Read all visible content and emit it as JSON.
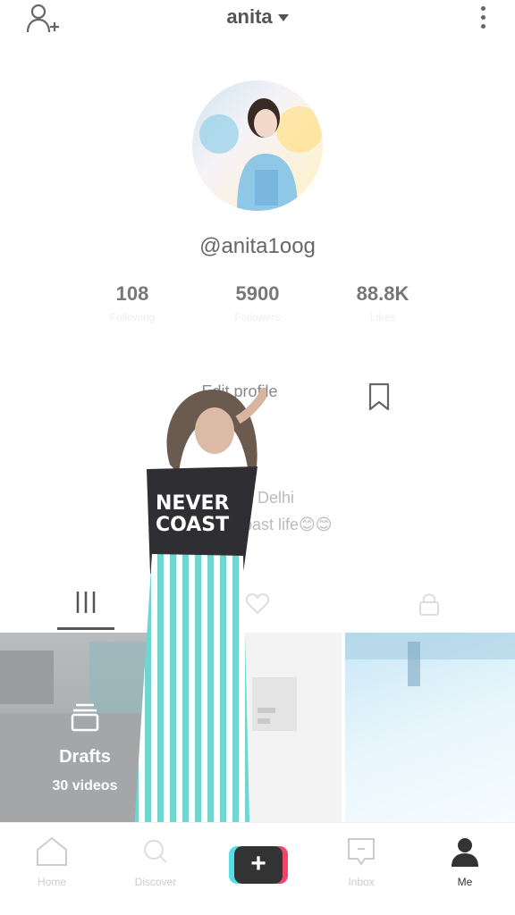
{
  "header": {
    "title": "anita",
    "add_user_icon": "add-user-icon",
    "more_icon": "more-vertical-icon"
  },
  "profile": {
    "handle": "@anita1oog",
    "stats": [
      {
        "value": "108",
        "label": "Following"
      },
      {
        "value": "5900",
        "label": "Followers"
      },
      {
        "value": "88.8K",
        "label": "Likes"
      }
    ],
    "edit_profile_label": "Edit profile",
    "bio_line1": "Delhi",
    "bio_line2": "bast life😊😊"
  },
  "tabs": [
    {
      "icon": "grid-icon",
      "active": true
    },
    {
      "icon": "heart-icon",
      "active": false
    },
    {
      "icon": "lock-icon",
      "active": false
    }
  ],
  "grid": {
    "drafts_label": "Drafts",
    "drafts_count": "30 videos"
  },
  "overlay": {
    "shirt_text_line1": "NEVER",
    "shirt_text_line2": "COAST"
  },
  "bottom_nav": {
    "items": [
      {
        "label": "Home",
        "icon": "home-icon"
      },
      {
        "label": "Discover",
        "icon": "search-icon"
      },
      {
        "label": "",
        "icon": "plus-icon"
      },
      {
        "label": "Inbox",
        "icon": "inbox-icon"
      },
      {
        "label": "Me",
        "icon": "person-icon"
      }
    ]
  },
  "colors": {
    "accent_cyan": "#55e0e8",
    "accent_pink": "#f3456a",
    "stripe_teal": "#6fd6d0"
  }
}
